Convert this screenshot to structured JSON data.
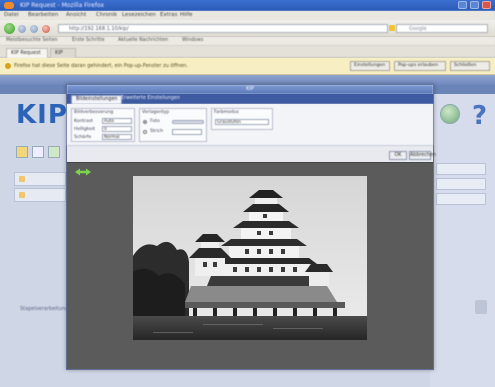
{
  "browser": {
    "window_title": "KIP Request - Mozilla Firefox",
    "menu": [
      "Datei",
      "Bearbeiten",
      "Ansicht",
      "Chronik",
      "Lesezeichen",
      "Extras",
      "Hilfe"
    ],
    "url": "http://192.168.1.10/kip/",
    "search_placeholder": "Google",
    "bookmarks": [
      "Meistbesuchte Seiten",
      "Erste Schritte",
      "Aktuelle Nachrichten",
      "Windows"
    ],
    "tabs": [
      "KIP Request",
      "KIP"
    ],
    "infobar_message": "Firefox hat diese Seite daran gehindert, ein Pop-up-Fenster zu öffnen.",
    "infobar_buttons": [
      "Einstellungen",
      "Pop-ups erlauben",
      "Schließen"
    ]
  },
  "app": {
    "logo": "KIP",
    "help_symbol": "?",
    "left_label": "Stapelverarbeitung",
    "left_rows": [
      "",
      ""
    ],
    "right_rows": [
      "",
      "",
      ""
    ]
  },
  "dialog": {
    "title": "KIP",
    "tabs": [
      "Bildeinstellungen",
      "Erweiterte Einstellungen"
    ],
    "groups": [
      {
        "title": "Bildverbesserung",
        "fields": [
          {
            "label": "Kontrast",
            "value": "Auto"
          },
          {
            "label": "Helligkeit",
            "value": "0"
          },
          {
            "label": "Schärfe",
            "value": "Normal"
          }
        ]
      },
      {
        "title": "Vorlagentyp",
        "options": [
          "Foto",
          "Strich"
        ],
        "selected": 0
      },
      {
        "title": "Farbmodus",
        "value": "Graustufen"
      }
    ],
    "action_buttons": [
      "OK",
      "Abbrechen"
    ]
  },
  "colors": {
    "accent": "#2b63b8",
    "titlebar": "#2a5ab8",
    "dialog_tabbar": "#3e5aa0",
    "viewer_bg": "#5b5b5b"
  }
}
